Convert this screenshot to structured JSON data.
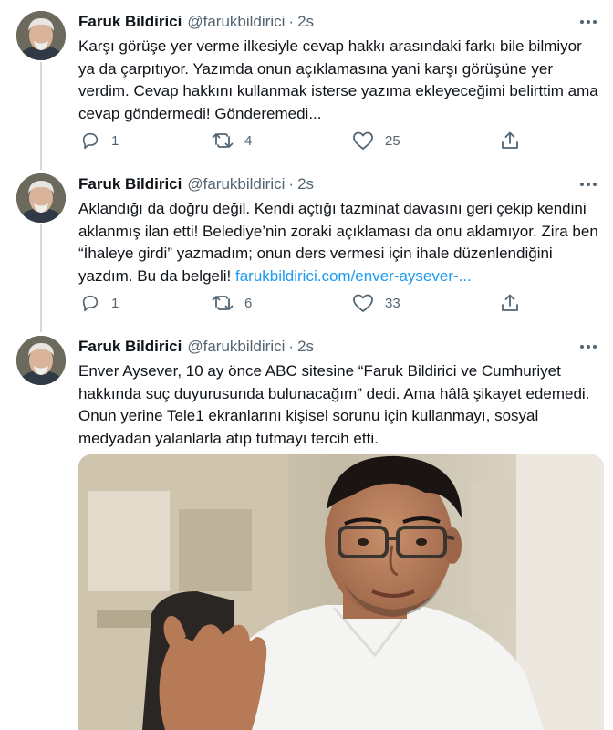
{
  "tweets": [
    {
      "name": "Faruk Bildirici",
      "handle": "@farukbildirici",
      "separator": "·",
      "time": "2s",
      "text": "Karşı görüşe yer verme ilkesiyle cevap hakkı arasındaki farkı bile bilmiyor ya da çarpıtıyor. Yazımda onun açıklamasına yani karşı görüşüne yer verdim. Cevap hakkını kullanmak isterse yazıma ekleyeceğimi belirttim ama cevap göndermedi! Gönderemedi...",
      "link": "",
      "replies": "1",
      "retweets": "4",
      "likes": "25"
    },
    {
      "name": "Faruk Bildirici",
      "handle": "@farukbildirici",
      "separator": "·",
      "time": "2s",
      "text": "Aklandığı da doğru değil. Kendi açtığı tazminat davasını geri çekip kendini aklanmış ilan etti! Belediye’nin zoraki açıklaması da onu aklamıyor. Zira ben “İhaleye girdi” yazmadım; onun ders vermesi için ihale düzenlendiğini yazdım. Bu da belgeli! ",
      "link": "farukbildirici.com/enver-aysever-...",
      "replies": "1",
      "retweets": "6",
      "likes": "33"
    },
    {
      "name": "Faruk Bildirici",
      "handle": "@farukbildirici",
      "separator": "·",
      "time": "2s",
      "text": "Enver Aysever, 10 ay önce ABC sitesine “Faruk Bildirici ve Cumhuriyet hakkında suç duyurusunda bulunacağım” dedi. Ama hâlâ şikayet edemedi. Onun yerine Tele1 ekranlarını kişisel sorunu için kullanmayı, sosyal medyadan yalanlarla atıp tutmayı tercih etti.",
      "link": ""
    }
  ],
  "icons": {
    "reply": "reply-icon",
    "retweet": "retweet-icon",
    "like": "heart-icon",
    "share": "share-icon",
    "more": "more-icon"
  },
  "colors": {
    "text": "#0f1419",
    "secondary": "#536471",
    "link": "#1d9bf0",
    "thread_line": "#cfd9de"
  }
}
